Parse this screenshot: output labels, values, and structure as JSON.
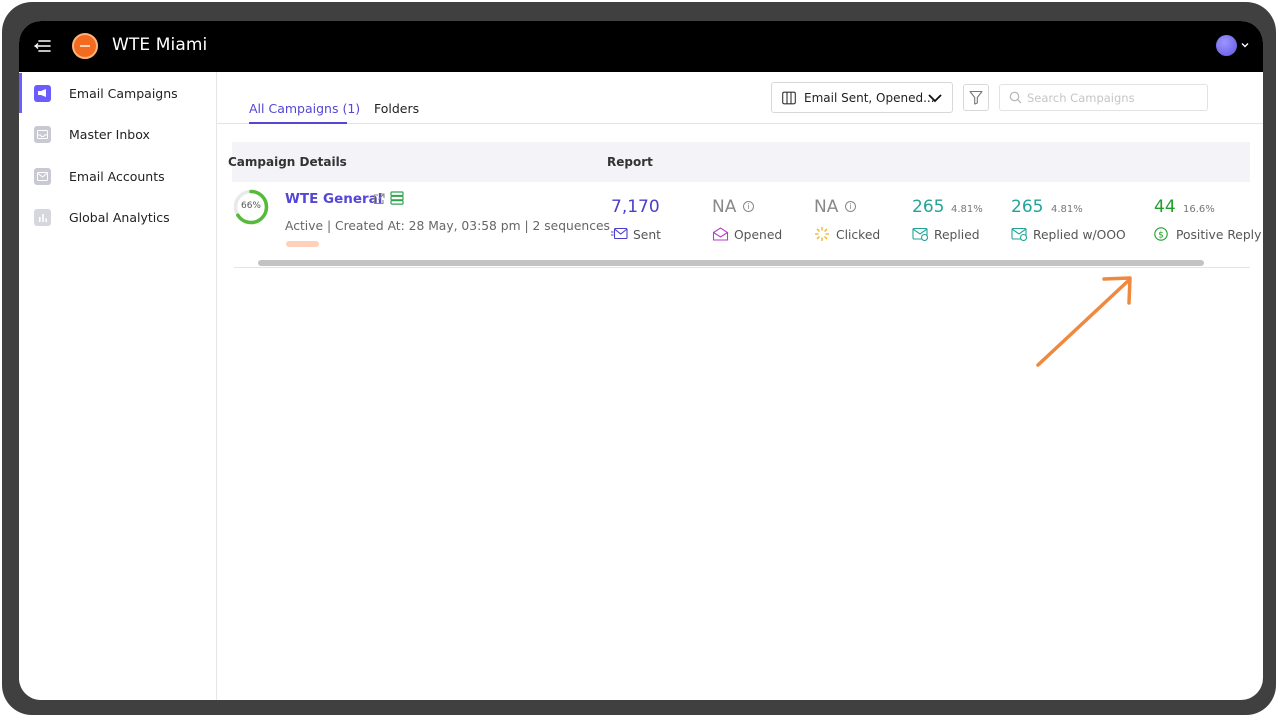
{
  "app": {
    "title": "WTE Miami"
  },
  "sidebar": {
    "items": [
      {
        "label": "Email Campaigns",
        "icon": "megaphone-icon",
        "active": true
      },
      {
        "label": "Master Inbox",
        "icon": "inbox-icon",
        "active": false
      },
      {
        "label": "Email Accounts",
        "icon": "mail-icon",
        "active": false
      },
      {
        "label": "Global Analytics",
        "icon": "bar-chart-icon",
        "active": false
      }
    ]
  },
  "tabs": [
    {
      "label": "All Campaigns (1)",
      "active": true
    },
    {
      "label": "Folders",
      "active": false
    }
  ],
  "toolbar": {
    "columns_dropdown": "Email Sent, Opened...",
    "search_placeholder": "Search Campaigns"
  },
  "table": {
    "headers": {
      "campaign_details": "Campaign Details",
      "report": "Report"
    },
    "row": {
      "progress_percent": 66,
      "progress_label": "66%",
      "name": "WTE General",
      "meta": "Active | Created At: 28 May, 03:58 pm | 2 sequences",
      "metrics": {
        "sent": {
          "value": "7,170",
          "label": "Sent"
        },
        "opened": {
          "value": "NA",
          "label": "Opened"
        },
        "clicked": {
          "value": "NA",
          "label": "Clicked"
        },
        "replied": {
          "value": "265",
          "pct": "4.81%",
          "label": "Replied"
        },
        "replied_wo_ooo": {
          "value": "265",
          "pct": "4.81%",
          "label": "Replied w/OOO"
        },
        "positive_reply": {
          "value": "44",
          "pct": "16.6%",
          "label": "Positive Reply"
        }
      }
    }
  },
  "colors": {
    "accent": "#5546d6",
    "teal": "#26a69a",
    "green": "#1e9e2b",
    "annotation_arrow": "#f0883e",
    "topbar": "#000000"
  }
}
